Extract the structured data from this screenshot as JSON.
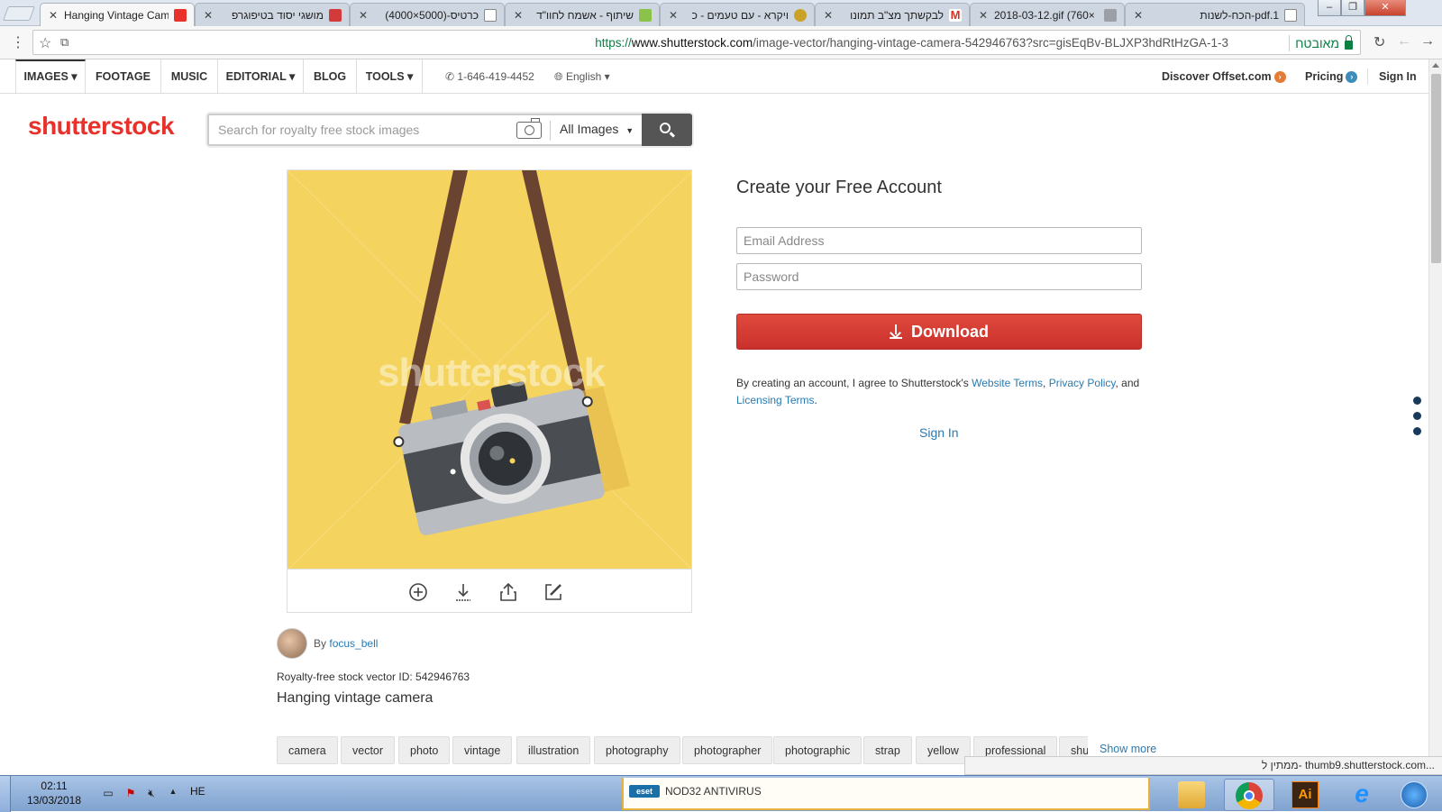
{
  "browser": {
    "tabs": [
      {
        "title": "Hanging Vintage Cam",
        "active": true,
        "favicon_color": "#e7312a"
      },
      {
        "title": "מושגי יסוד בטיפוגרפ",
        "active": false,
        "favicon_color": "#d33b3b"
      },
      {
        "title": "כרטיס-(5000×4000)",
        "active": false,
        "favicon_color": "#888888"
      },
      {
        "title": "שיתוף - אשמח לחוו\"ד",
        "active": false,
        "favicon_color": "#8bc34a"
      },
      {
        "title": "ויקרא - עם טעמים - כ",
        "active": false,
        "favicon_color": "#c9a227"
      },
      {
        "title": "לבקשתך מצ\"ב תמונו",
        "active": false,
        "favicon_color": "#d93025"
      },
      {
        "title": "2018-03-12.gif (760×",
        "active": false,
        "favicon_color": "#9aa0a6"
      },
      {
        "title": "pdf.1-הכח-לשנות",
        "active": false,
        "favicon_color": "#888888"
      }
    ],
    "url": {
      "scheme": "https://",
      "host": "www.shutterstock.com",
      "path": "/image-vector/hanging-vintage-camera-542946763?src=gisEqBv-BLJXP3hdRtHzGA-1-3"
    },
    "secure_label": "מאובטח",
    "status_url": "ממתין ל- thumb9.shutterstock.com..."
  },
  "nav": {
    "items": [
      "IMAGES ▾",
      "FOOTAGE",
      "MUSIC",
      "EDITORIAL ▾",
      "BLOG",
      "TOOLS ▾"
    ],
    "phone": "1-646-419-4452",
    "language": "English ▾",
    "offset": "Discover Offset.com",
    "pricing": "Pricing",
    "signin": "Sign In"
  },
  "brand": {
    "logo": "shutterstock",
    "color": "#e7312a"
  },
  "search": {
    "placeholder": "Search for royalty free stock images",
    "scope": "All Images"
  },
  "preview": {
    "watermark": "shutterstock",
    "background": "#f4d35e",
    "tools": [
      "add-to-lightbox-icon",
      "download-icon",
      "share-icon",
      "edit-icon"
    ]
  },
  "meta": {
    "by": "By",
    "author": "focus_bell",
    "id_label": "Royalty-free stock vector ID: 542946763",
    "title": "Hanging vintage camera",
    "tags": [
      "camera",
      "vector",
      "photo",
      "vintage",
      "illustration",
      "photography",
      "photographer",
      "photographic",
      "strap",
      "yellow",
      "professional",
      "shu"
    ],
    "show_more": "Show more"
  },
  "account": {
    "title": "Create your Free Account",
    "email_placeholder": "Email Address",
    "password_placeholder": "Password",
    "download": "Download",
    "terms_prefix": "By creating an account, I agree to Shutterstock's",
    "website_terms": "Website Terms",
    "comma": ",",
    "privacy": "Privacy Policy",
    "and": ", and",
    "licensing": "Licensing Terms",
    "period": ".",
    "signin": "Sign In"
  },
  "taskbar": {
    "time": "02:11",
    "date": "13/03/2018",
    "lang": "HE",
    "eset": "NOD32 ANTIVIRUS",
    "eset_logo": "eset",
    "ai_label": "Ai"
  }
}
